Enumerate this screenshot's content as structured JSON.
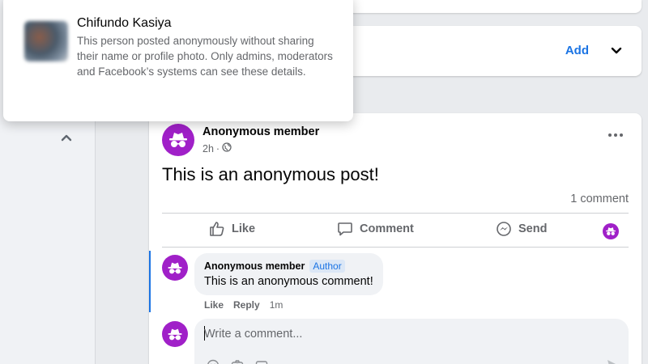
{
  "tooltip": {
    "name": "Chifundo Kasiya",
    "description": "This person posted anonymously without sharing their name or profile photo. Only admins, moderators and Facebook’s systems can see these details."
  },
  "add_card": {
    "add_label": "Add"
  },
  "post": {
    "author": "Anonymous member",
    "time": "2h",
    "separator": "·",
    "text": "This is an anonymous post!",
    "comment_count": "1 comment"
  },
  "actions": {
    "like": "Like",
    "comment": "Comment",
    "send": "Send"
  },
  "comment": {
    "author": "Anonymous member",
    "badge": "Author",
    "text": "This is an anonymous comment!",
    "like": "Like",
    "reply": "Reply",
    "time": "1m"
  },
  "composer": {
    "placeholder": "Write a comment..."
  },
  "colors": {
    "accent": "#1b74e4",
    "anon_avatar": "#a020c8",
    "background": "#e9ebee"
  },
  "icons": [
    "incognito-icon",
    "globe-icon",
    "like-icon",
    "comment-icon",
    "messenger-icon",
    "chevron-up-icon",
    "chevron-down-icon",
    "more-icon",
    "emoji-icon",
    "camera-icon",
    "gif-icon",
    "send-arrow-icon"
  ]
}
